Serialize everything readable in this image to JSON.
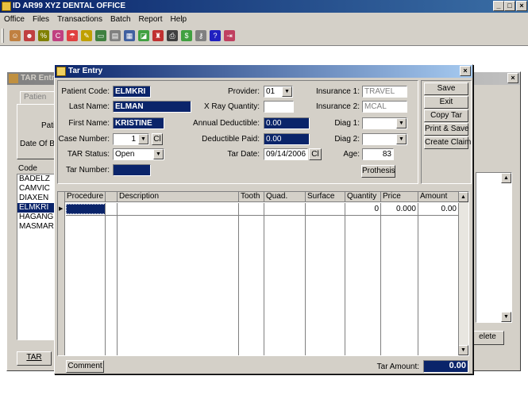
{
  "app": {
    "title": "ID AR99  XYZ DENTAL OFFICE",
    "menu": [
      "Office",
      "Files",
      "Transactions",
      "Batch",
      "Report",
      "Help"
    ],
    "controls": {
      "min": "_",
      "max": "□",
      "close": "×"
    },
    "toolbar_icons": [
      "users-icon",
      "group-icon",
      "codes-icon",
      "tag-icon",
      "umbrella-icon",
      "pencil-icon",
      "card-icon",
      "receipt-icon",
      "folder-icon",
      "disk-icon",
      "stamp-icon",
      "printer-icon",
      "money-bag-icon",
      "key-icon",
      "help-icon",
      "exit-icon"
    ],
    "toolbar_glyphs": [
      "☺",
      "☻",
      "%",
      "C",
      "☂",
      "✎",
      "▭",
      "▤",
      "▦",
      "◪",
      "♜",
      "⎙",
      "$",
      "⚷",
      "?",
      "⇥"
    ],
    "toolbar_colors": [
      "#c08040",
      "#c04040",
      "#808000",
      "#c04080",
      "#e04040",
      "#c0a000",
      "#408040",
      "#808080",
      "#4060a0",
      "#40a040",
      "#c03030",
      "#404040",
      "#40a040",
      "#808080",
      "#2020c0",
      "#c04060"
    ]
  },
  "bg_window": {
    "title": "TAR Entr",
    "tab": "Patien",
    "labels": {
      "patient": "Pati",
      "dob": "Date Of Bi"
    },
    "code_header": "Code",
    "codes": [
      "BADELZ",
      "CAMVIC",
      "DIAXEN",
      "ELMKRI",
      "HAGANG",
      "MASMAR"
    ],
    "selected_index": 3,
    "tar_tab": "TAR",
    "delete_label": "elete"
  },
  "dialog": {
    "title": "Tar Entry",
    "patient_code_label": "Patient Code:",
    "patient_code": "ELMKRI",
    "last_name_label": "Last Name:",
    "last_name": "ELMAN",
    "first_name_label": "First Name:",
    "first_name": "KRISTINE",
    "case_number_label": "Case Number:",
    "case_number": "1",
    "cl_label": "Cl",
    "tar_status_label": "TAR Status:",
    "tar_status": "Open",
    "tar_number_label": "Tar Number:",
    "tar_number": "",
    "provider_label": "Provider:",
    "provider": "01",
    "xray_label": "X Ray Quantity:",
    "xray": "",
    "annual_deductible_label": "Annual Deductible:",
    "annual_deductible": "0.00",
    "deductible_paid_label": "Deductible Paid:",
    "deductible_paid": "0.00",
    "tar_date_label": "Tar Date:",
    "tar_date": "09/14/2006",
    "insurance1_label": "Insurance 1:",
    "insurance1": "TRAVEL",
    "insurance2_label": "Insurance 2:",
    "insurance2": "MCAL",
    "diag1_label": "Diag 1:",
    "diag1": "",
    "diag2_label": "Diag 2:",
    "diag2": "",
    "age_label": "Age:",
    "age": "83",
    "prothesis_label": "Prothesis",
    "buttons": {
      "save": "Save",
      "exit": "Exit",
      "copy_tar": "Copy Tar",
      "print_save": "Print & Save",
      "create_claim": "Create Claim"
    },
    "grid": {
      "columns": [
        "Procedure",
        "",
        "Description",
        "Tooth",
        "Quad.",
        "Surface",
        "Quantity",
        "Price",
        "Amount"
      ],
      "row": {
        "quantity": "0",
        "price": "0.000",
        "amount": "0.00"
      }
    },
    "comment_label": "Comment",
    "tar_amount_label": "Tar Amount:",
    "tar_amount": "0.00"
  }
}
